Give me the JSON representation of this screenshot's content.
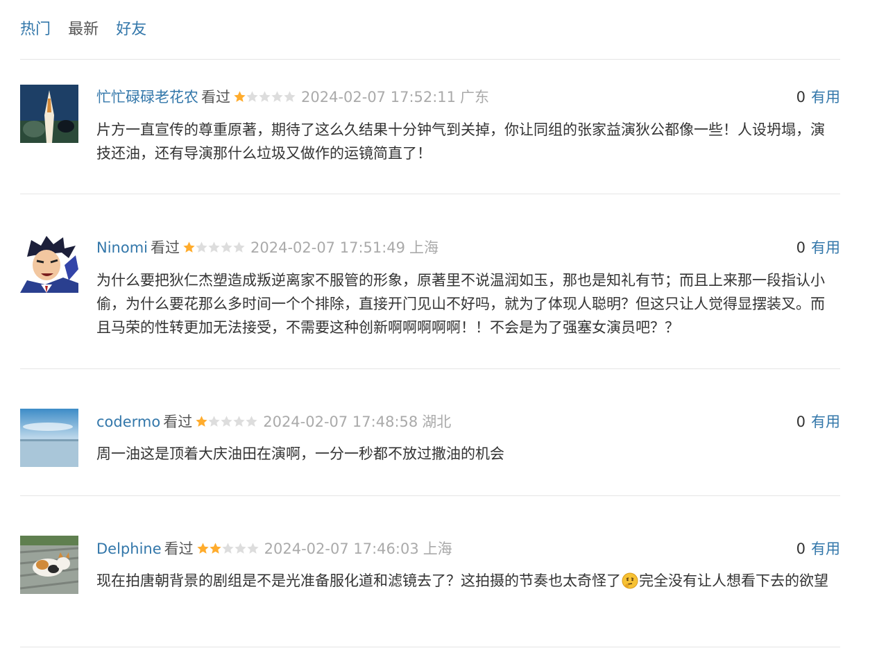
{
  "tabs": [
    {
      "label": "热门",
      "style": "link"
    },
    {
      "label": "最新",
      "style": "plain"
    },
    {
      "label": "好友",
      "style": "link"
    }
  ],
  "comments": [
    {
      "user": "忙忙碌碌老花农",
      "action": "看过",
      "rating": 1,
      "time": "2024-02-07 17:52:11",
      "location": "广东",
      "votes": "0",
      "useful_label": "有用",
      "text_parts": [
        "片方一直宣传的尊重原著，期待了这么久结果十分钟气到关掉，你让同组的张家益演狄公都像一些！人设坍塌，演技还油，还有导演那什么垃圾又做作的运镜简直了！"
      ],
      "avatar_icon": "rocket-avatar-icon"
    },
    {
      "user": "Ninomi",
      "action": "看过",
      "rating": 1,
      "time": "2024-02-07 17:51:49",
      "location": "上海",
      "votes": "0",
      "useful_label": "有用",
      "text_parts": [
        "为什么要把狄仁杰塑造成叛逆离家不服管的形象，原著里不说温润如玉，那也是知礼有节；而且上来那一段指认小偷，为什么要花那么多时间一个个排除，直接开门见山不好吗，就为了体现人聪明？但这只让人觉得显摆装叉。而且马荣的性转更加无法接受，不需要这种创新啊啊啊啊啊！！不会是为了强塞女演员吧？？"
      ],
      "avatar_icon": "anime-character-avatar-icon"
    },
    {
      "user": "codermo",
      "action": "看过",
      "rating": 1,
      "time": "2024-02-07 17:48:58",
      "location": "湖北",
      "votes": "0",
      "useful_label": "有用",
      "text_parts": [
        "周一油这是顶着大庆油田在演啊，一分一秒都不放过撒油的机会"
      ],
      "avatar_icon": "sky-lake-avatar-icon"
    },
    {
      "user": "Delphine",
      "action": "看过",
      "rating": 2,
      "time": "2024-02-07 17:46:03",
      "location": "上海",
      "votes": "0",
      "useful_label": "有用",
      "text_parts": [
        "现在拍唐朝背景的剧组是不是光准备服化道和滤镜去了？这拍摄的节奏也太奇怪了",
        "完全没有让人想看下去的欲望"
      ],
      "emoji_icon": "thinking-face-emoji-icon",
      "avatar_icon": "cat-avatar-icon"
    }
  ],
  "colors": {
    "link": "#3377aa",
    "star_on": "#ffac2d",
    "star_off": "#dddddd",
    "meta": "#aaaaaa"
  }
}
